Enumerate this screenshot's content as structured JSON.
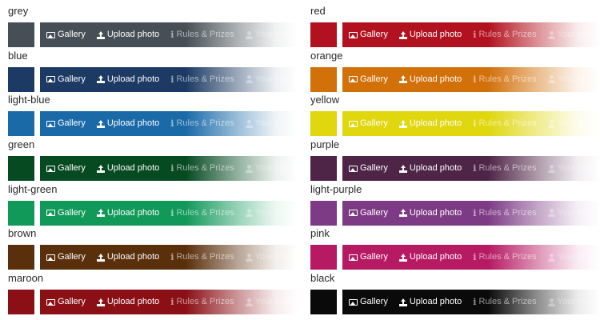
{
  "nav": {
    "gallery": "Gallery",
    "upload": "Upload photo",
    "rules": "Rules & Prizes",
    "your_images": "Your Ima"
  },
  "left_column": [
    {
      "name": "grey",
      "color": "#464f55"
    },
    {
      "name": "blue",
      "color": "#1c3a64"
    },
    {
      "name": "light-blue",
      "color": "#1a6aa8"
    },
    {
      "name": "green",
      "color": "#064a22"
    },
    {
      "name": "light-green",
      "color": "#11995a"
    },
    {
      "name": "brown",
      "color": "#5a2f0c"
    },
    {
      "name": "maroon",
      "color": "#8a1016"
    }
  ],
  "right_column": [
    {
      "name": "red",
      "color": "#b2121f"
    },
    {
      "name": "orange",
      "color": "#d2700a"
    },
    {
      "name": "yellow",
      "color": "#e0d70e"
    },
    {
      "name": "purple",
      "color": "#4f2547"
    },
    {
      "name": "light-purple",
      "color": "#7d3b86"
    },
    {
      "name": "pink",
      "color": "#b61a63"
    },
    {
      "name": "black",
      "color": "#0a0a0a"
    }
  ]
}
